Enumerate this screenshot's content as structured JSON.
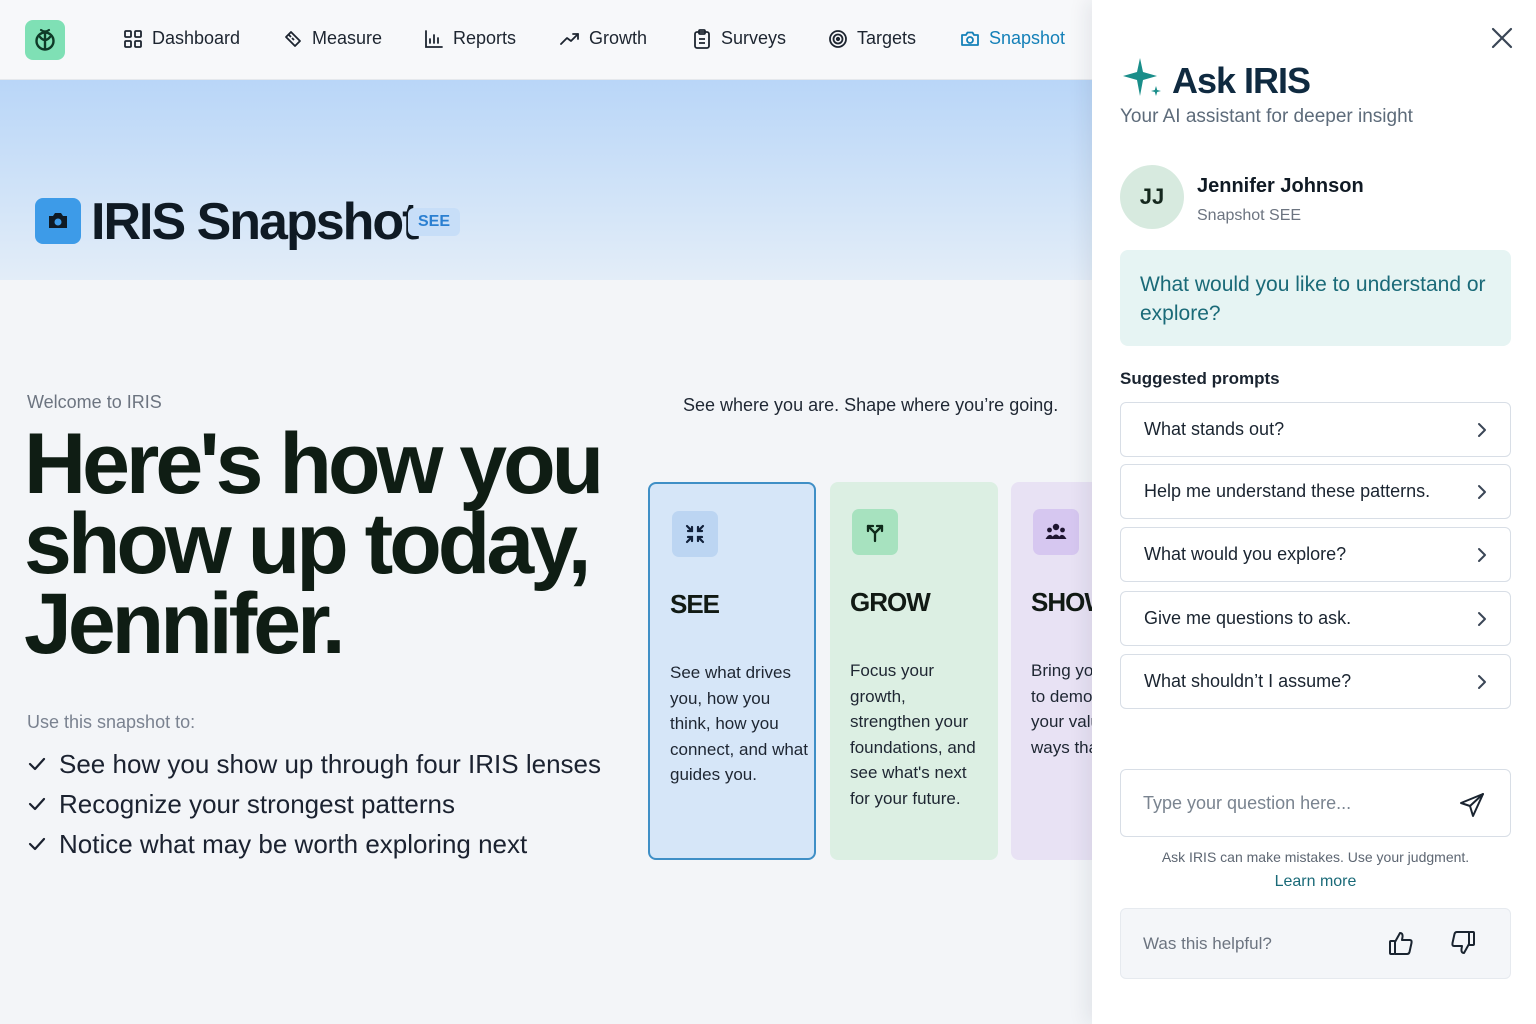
{
  "nav": {
    "items": [
      {
        "label": "Dashboard",
        "icon": "grid-icon"
      },
      {
        "label": "Measure",
        "icon": "ruler-icon"
      },
      {
        "label": "Reports",
        "icon": "bar-chart-icon"
      },
      {
        "label": "Growth",
        "icon": "trend-up-icon"
      },
      {
        "label": "Surveys",
        "icon": "clipboard-icon"
      },
      {
        "label": "Targets",
        "icon": "target-icon"
      },
      {
        "label": "Snapshot",
        "icon": "camera-icon",
        "active": true
      }
    ]
  },
  "hero": {
    "title": "IRIS Snapshot",
    "badge": "SEE"
  },
  "main": {
    "welcome": "Welcome to IRIS",
    "headline": "Here's how you show up today, Jennifer.",
    "use_label": "Use this snapshot to:",
    "checklist": [
      "See how you show up through four IRIS lenses",
      "Recognize your strongest patterns",
      "Notice what may be worth exploring next"
    ],
    "tagline": "See where you are. Shape where you’re going."
  },
  "cards": [
    {
      "title": "SEE",
      "text": "See what drives you, how you think, how you connect, and what guides you.",
      "icon": "compress-arrows-icon"
    },
    {
      "title": "GROW",
      "text": "Focus your growth, strengthen your foundations, and see what's next for your future.",
      "icon": "branch-icon"
    },
    {
      "title": "SHOW",
      "text": "Bring your impact to demonstrate your values in ways that matter.",
      "icon": "people-icon"
    }
  ],
  "panel": {
    "title": "Ask IRIS",
    "subtitle": "Your AI assistant for deeper insight",
    "user": {
      "initials": "JJ",
      "name": "Jennifer Johnson",
      "sub": "Snapshot SEE"
    },
    "question": "What would you like to understand or explore?",
    "prompts_label": "Suggested prompts",
    "prompts": [
      "What stands out?",
      "Help me understand these patterns.",
      "What would you explore?",
      "Give me questions to ask.",
      "What shouldn’t I assume?"
    ],
    "input_placeholder": "Type your question here...",
    "disclaimer": "Ask IRIS can make mistakes. Use your judgment.",
    "learn_more": "Learn more",
    "feedback_label": "Was this helpful?"
  },
  "colors": {
    "accent": "#1480b8",
    "brand_green": "#7fe0b5",
    "hero_blue": "#b9d6f8",
    "teal_text": "#1a6a78"
  }
}
